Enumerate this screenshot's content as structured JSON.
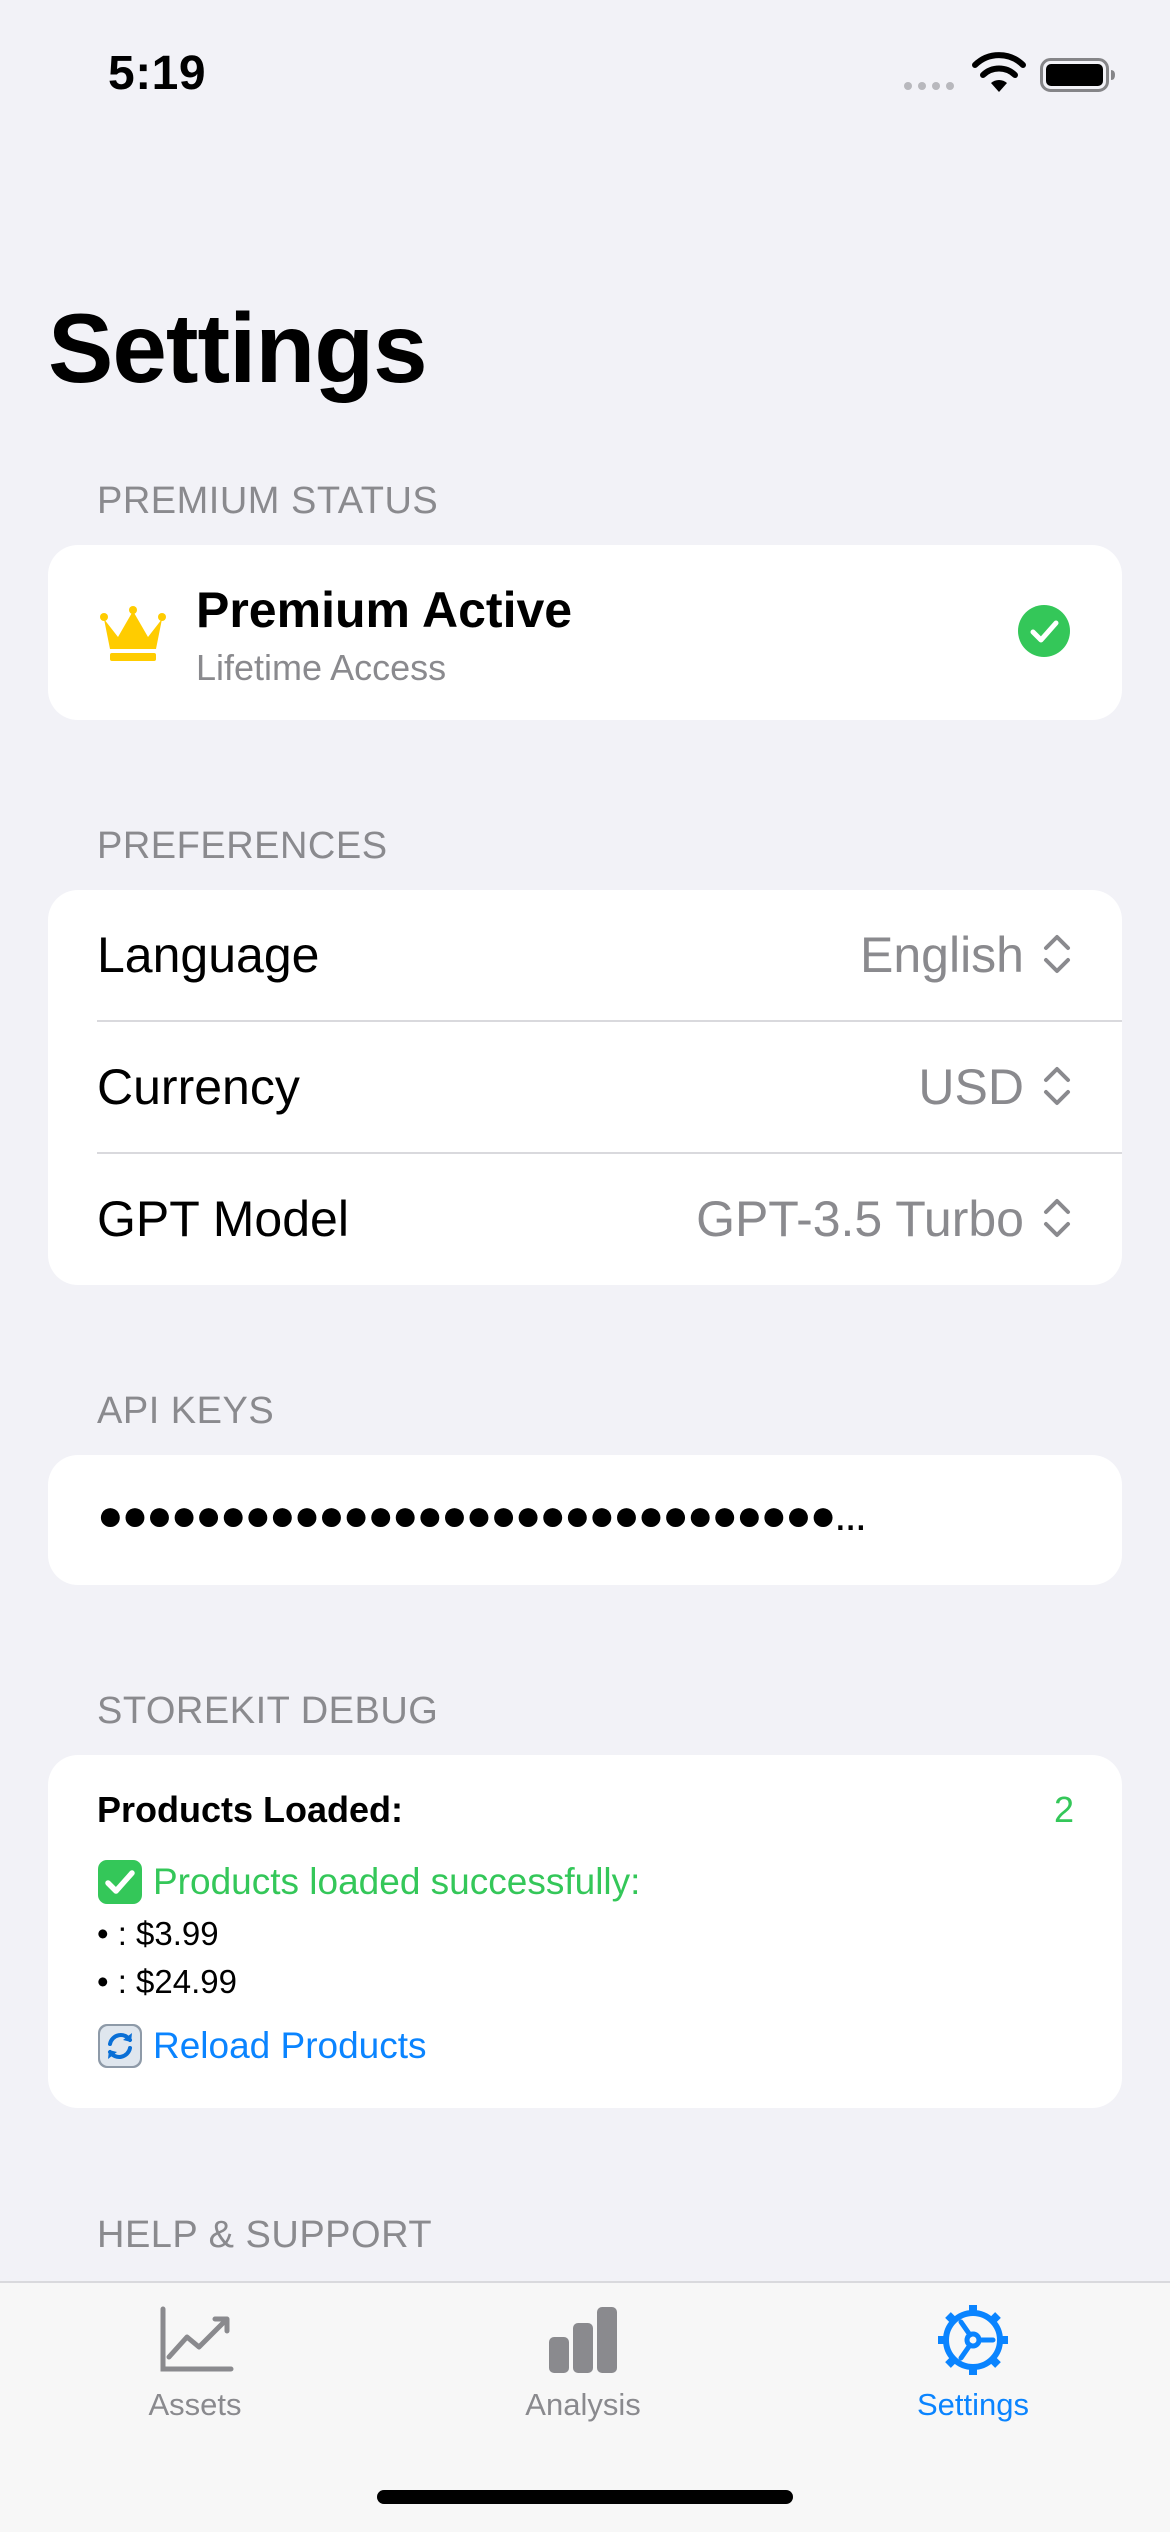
{
  "status_bar": {
    "time": "5:19"
  },
  "page": {
    "title": "Settings"
  },
  "premium": {
    "header": "PREMIUM STATUS",
    "title": "Premium Active",
    "subtitle": "Lifetime Access",
    "icon": "crown-icon",
    "status_icon": "checkmark-circle-icon",
    "accent": "#34c759"
  },
  "preferences": {
    "header": "PREFERENCES",
    "rows": [
      {
        "label": "Language",
        "value": "English"
      },
      {
        "label": "Currency",
        "value": "USD"
      },
      {
        "label": "GPT Model",
        "value": "GPT-3.5 Turbo"
      }
    ]
  },
  "api_keys": {
    "header": "API KEYS",
    "masked_value": "●●●●●●●●●●●●●●●●●●●●●●●●●●●●●●..."
  },
  "storekit": {
    "header": "STOREKIT DEBUG",
    "products_label": "Products Loaded:",
    "products_count": "2",
    "success_message": "Products loaded successfully:",
    "products": [
      "• : $3.99",
      "• : $24.99"
    ],
    "reload_label": "Reload Products"
  },
  "help": {
    "header": "HELP & SUPPORT"
  },
  "tab_bar": {
    "tabs": [
      {
        "label": "Assets",
        "icon": "chart-line-icon",
        "active": false
      },
      {
        "label": "Analysis",
        "icon": "bar-chart-icon",
        "active": false
      },
      {
        "label": "Settings",
        "icon": "gear-icon",
        "active": true
      }
    ],
    "active_color": "#0a84ff",
    "inactive_color": "#8a8a8e"
  }
}
